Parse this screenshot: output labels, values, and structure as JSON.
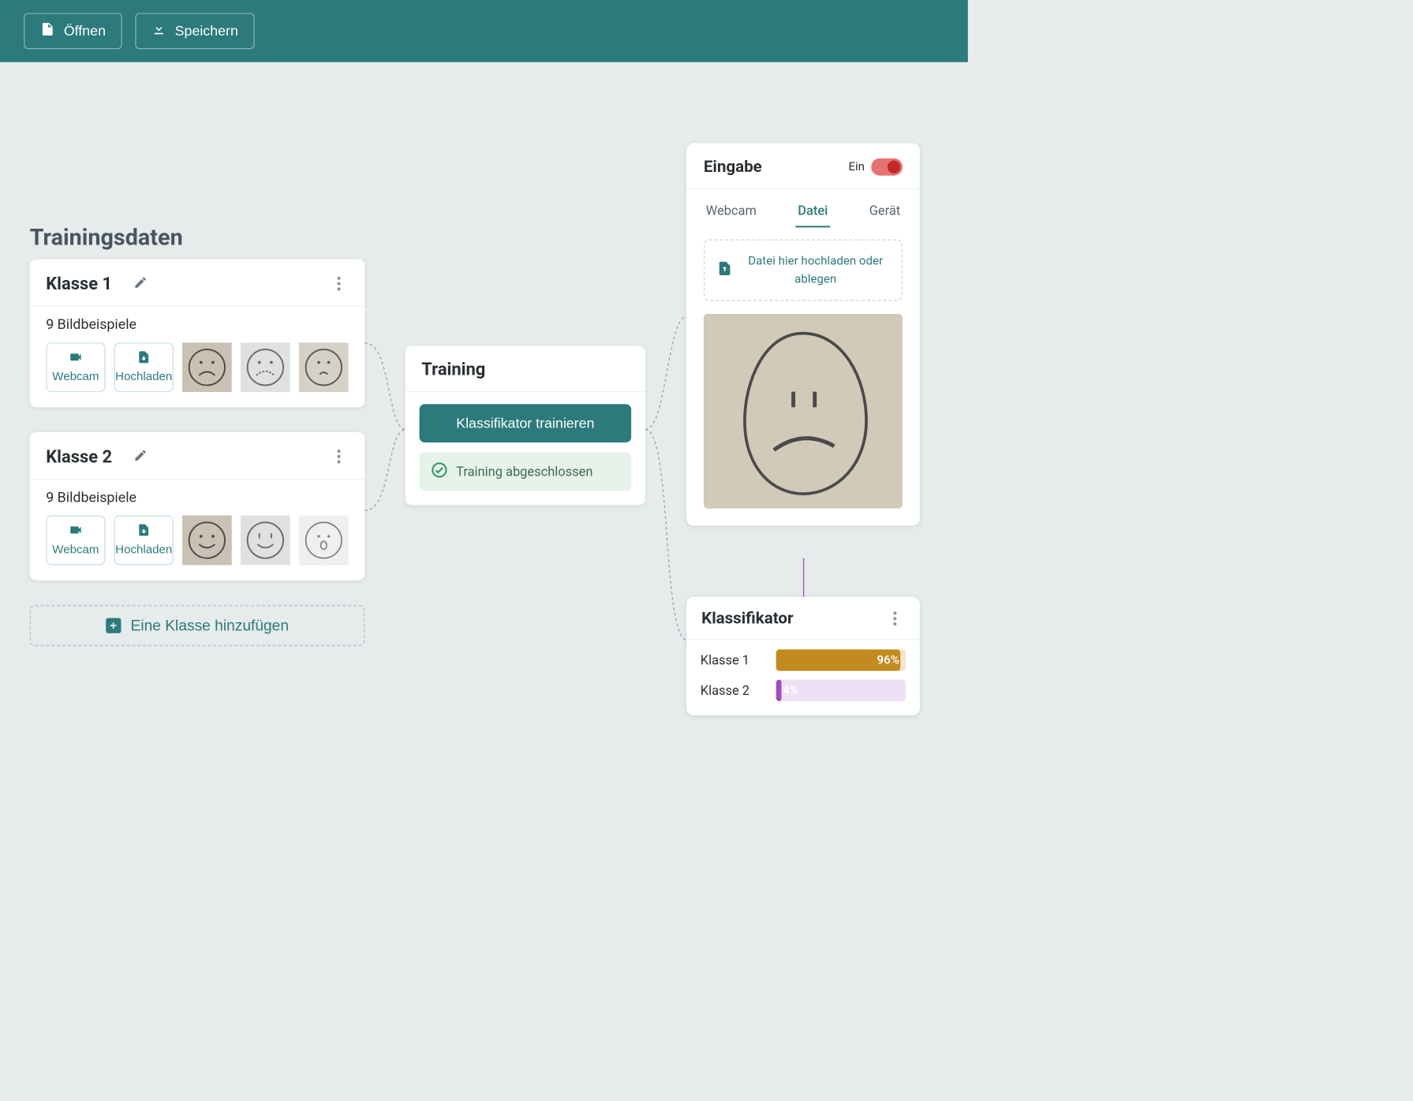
{
  "topbar": {
    "open_label": "Öffnen",
    "save_label": "Speichern"
  },
  "training_data": {
    "title": "Trainingsdaten",
    "add_class_label": "Eine Klasse hinzufügen",
    "classes": [
      {
        "name": "Klasse 1",
        "example_count_text": "9 Bildbeispiele",
        "webcam_label": "Webcam",
        "upload_label": "Hochladen",
        "sample_kind": "sad"
      },
      {
        "name": "Klasse 2",
        "example_count_text": "9 Bildbeispiele",
        "webcam_label": "Webcam",
        "upload_label": "Hochladen",
        "sample_kind": "happy"
      }
    ]
  },
  "training": {
    "title": "Training",
    "train_button": "Klassifikator trainieren",
    "status_text": "Training abgeschlossen"
  },
  "input_panel": {
    "title": "Eingabe",
    "toggle_label": "Ein",
    "toggle_on": true,
    "tabs": [
      "Webcam",
      "Datei",
      "Gerät"
    ],
    "active_tab": "Datei",
    "dropzone_text": "Datei hier hochladen oder ablegen",
    "preview_kind": "sad_egg"
  },
  "classifier": {
    "title": "Klassifikator",
    "rows": [
      {
        "name": "Klasse 1",
        "pct": 96,
        "color": "gold"
      },
      {
        "name": "Klasse 2",
        "pct": 4,
        "color": "purple"
      }
    ]
  }
}
